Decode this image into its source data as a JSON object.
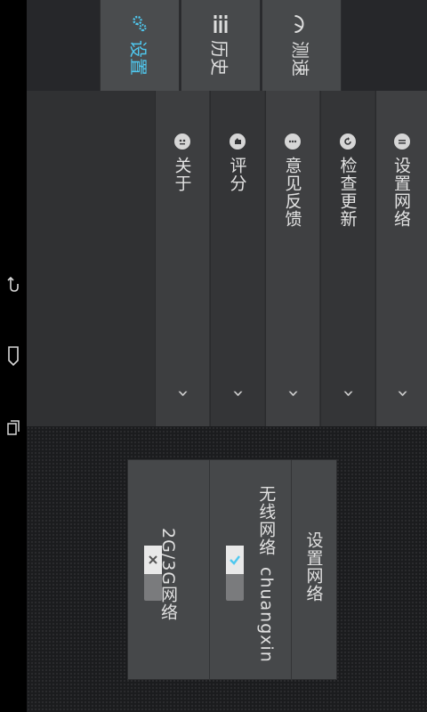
{
  "tabs": [
    {
      "label": "测速",
      "icon": "speedometer-icon"
    },
    {
      "label": "历史",
      "icon": "list-icon"
    },
    {
      "label": "设置",
      "icon": "gears-icon",
      "active": true
    }
  ],
  "settings": {
    "items": [
      {
        "label": "设置网络",
        "icon": "network-icon"
      },
      {
        "label": "检查更新",
        "icon": "refresh-icon"
      },
      {
        "label": "意见反馈",
        "icon": "feedback-icon"
      },
      {
        "label": "评分",
        "icon": "rating-icon"
      },
      {
        "label": "关于",
        "icon": "about-icon"
      }
    ],
    "chevron": "›"
  },
  "dialog": {
    "title": "设置网络",
    "wifi_label": "无线网络",
    "wifi_ssid": "chuangxin",
    "wifi_enabled": true,
    "mobile_label": "2G/3G网络",
    "mobile_enabled": false
  },
  "colors": {
    "accent": "#4fc8ef"
  }
}
